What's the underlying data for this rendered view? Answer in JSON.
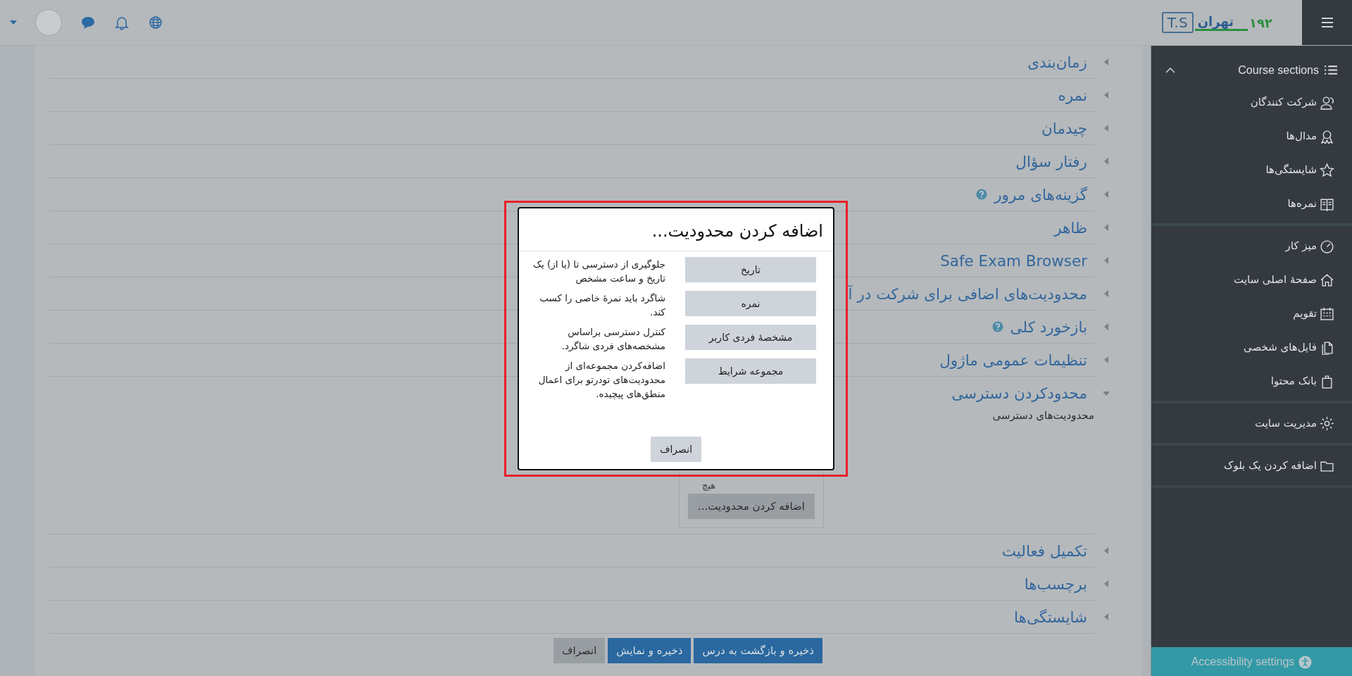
{
  "topbar": {
    "logo": {
      "badge": "T.S",
      "name": "تهران",
      "number": "۱۹۲"
    }
  },
  "sections": [
    {
      "title": "زمان‌بندی",
      "expanded": false,
      "help": false
    },
    {
      "title": "نمره",
      "expanded": false,
      "help": false
    },
    {
      "title": "چیدمان",
      "expanded": false,
      "help": false
    },
    {
      "title": "رفتار سؤال",
      "expanded": false,
      "help": false
    },
    {
      "title": "گزینه‌های مرور",
      "expanded": false,
      "help": true
    },
    {
      "title": "ظاهر",
      "expanded": false,
      "help": false
    },
    {
      "title": "Safe Exam Browser",
      "expanded": false,
      "help": false
    },
    {
      "title": "محدودیت‌های اضافی برای شرکت در آ",
      "expanded": false,
      "help": false
    },
    {
      "title": "بازخورد کلی",
      "expanded": false,
      "help": true
    },
    {
      "title": "تنظیمات عمومی ماژول",
      "expanded": false,
      "help": false
    },
    {
      "title": "محدودکردن دسترسی",
      "expanded": true,
      "help": false,
      "field_label": "محدودیت‌های دسترسی",
      "value": "هیچ",
      "button": "اضافه کردن محدودیت..."
    },
    {
      "title": "تکمیل فعالیت",
      "expanded": false,
      "help": false
    },
    {
      "title": "برچسب‌ها",
      "expanded": false,
      "help": false
    },
    {
      "title": "شایستگی‌ها",
      "expanded": false,
      "help": false
    }
  ],
  "form_buttons": [
    {
      "label": "ذخیره و بازگشت به درس",
      "kind": "primary"
    },
    {
      "label": "ذخیره و نمایش",
      "kind": "primary"
    },
    {
      "label": "انصراف",
      "kind": "secondary"
    }
  ],
  "sidebar": {
    "header": "Course sections",
    "groups": [
      [
        "شرکت کنندگان",
        "مدال‌ها",
        "شایستگی‌ها",
        "نمره‌ها"
      ],
      [
        "میز کار",
        "صفحهٔ اصلی سایت",
        "تقویم",
        "فایل‌های شخصی",
        "بانک محتوا"
      ],
      [
        "مدیریت سایت"
      ],
      [
        "اضافه کردن یک بلوک"
      ]
    ],
    "footer": "Accessibility settings"
  },
  "dialog": {
    "title": "اضافه کردن محدودیت...",
    "options": [
      {
        "button": "تاریخ",
        "description": "جلوگیری از دسترسی تا (یا از) یک تاریخ و ساعت مشخص"
      },
      {
        "button": "نمره",
        "description": "شاگرد باید نمرهٔ خاصی را کسب کند."
      },
      {
        "button": "مشخصهٔ فردی کاربر",
        "description": "کنترل دسترسی براساس مشخصه‌های فردی شاگرد."
      },
      {
        "button": "مجموعه شرایط",
        "description": "اضافه‌کردن مجموعه‌ای از محدودیت‌های تودرتو برای اعمال منطق‌های پیچیده."
      }
    ],
    "cancel": "انصراف"
  }
}
